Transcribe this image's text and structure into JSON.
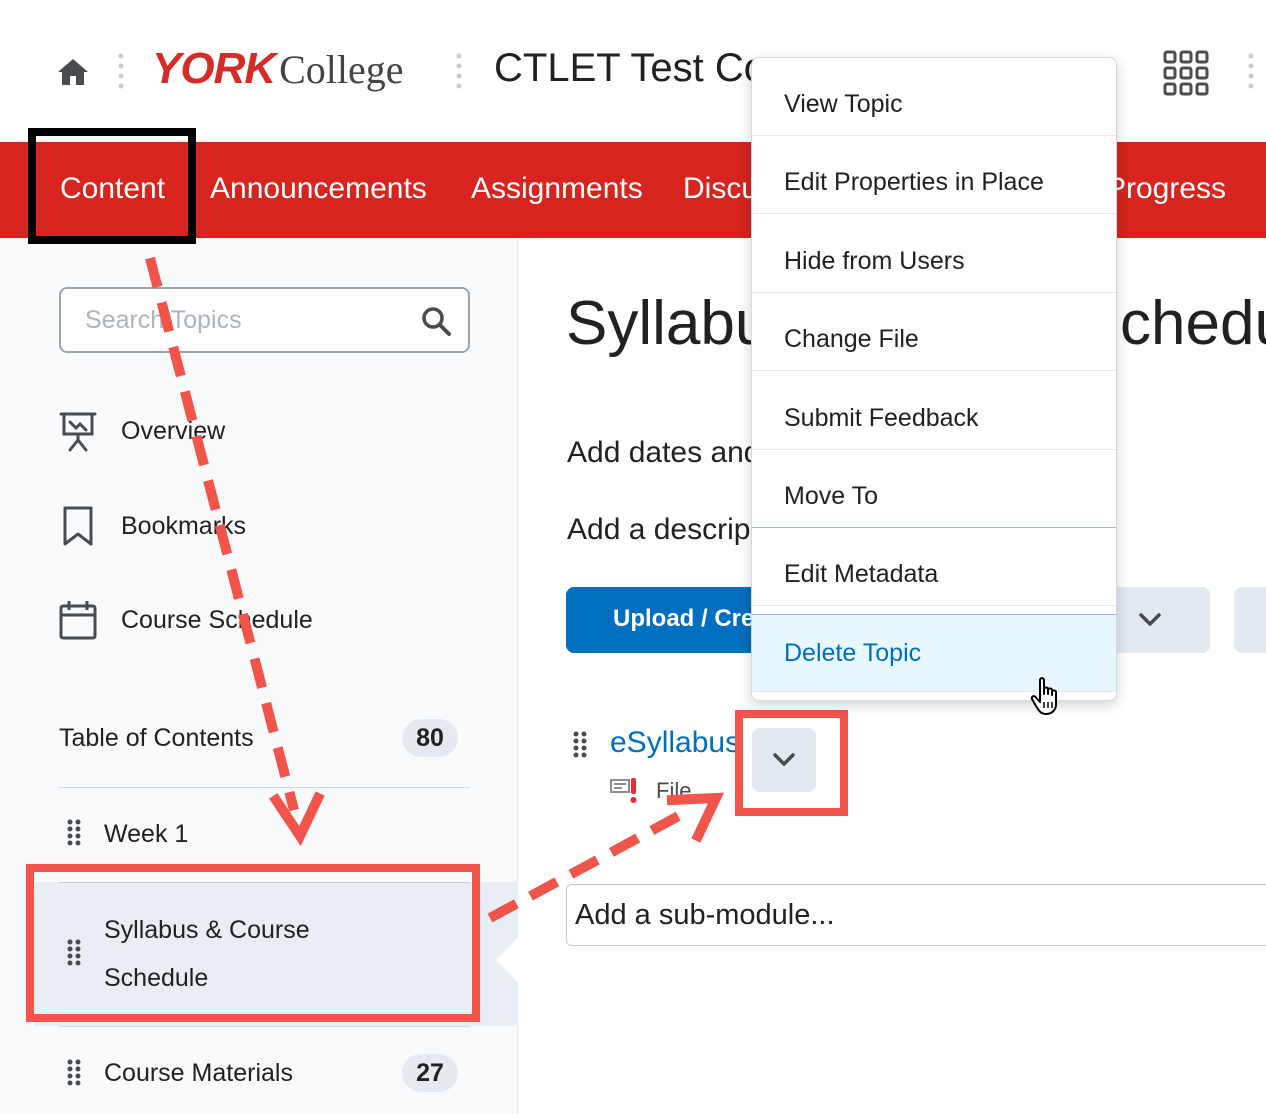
{
  "header": {
    "logo_york": "YORK",
    "logo_college": "College",
    "course_title": "CTLET Test Co"
  },
  "nav": {
    "items": [
      {
        "label": "Content"
      },
      {
        "label": "Announcements"
      },
      {
        "label": "Assignments"
      },
      {
        "label": "Discu"
      },
      {
        "label": "Progress"
      }
    ]
  },
  "sidebar": {
    "search_placeholder": "Search Topics",
    "links": [
      {
        "label": "Overview",
        "icon": "presentation-board-icon"
      },
      {
        "label": "Bookmarks",
        "icon": "bookmark-icon"
      },
      {
        "label": "Course Schedule",
        "icon": "calendar-icon"
      }
    ],
    "toc_title": "Table of Contents",
    "toc_count": "80",
    "modules": [
      {
        "label": "Week 1"
      },
      {
        "label_line1": "Syllabus & Course",
        "label_line2": "Schedule"
      },
      {
        "label": "Course Materials",
        "count": "27"
      }
    ]
  },
  "main": {
    "title_left": "Syllabu",
    "title_right": "chedu",
    "add_dates": "Add dates and",
    "add_description": "Add a descrip",
    "upload_label": "Upload / Crea",
    "topic": {
      "name": "eSyllabus",
      "type": "File"
    },
    "add_submodule": "Add a sub-module..."
  },
  "dropdown": {
    "items": [
      {
        "label": "View Topic"
      },
      {
        "label": "Edit Properties in Place"
      },
      {
        "label": "Hide from Users"
      },
      {
        "label": "Change File"
      },
      {
        "label": "Submit Feedback"
      },
      {
        "label": "Move To"
      },
      {
        "label": "Edit Metadata"
      },
      {
        "label": "Delete Topic"
      }
    ],
    "hovered": "Delete Topic"
  },
  "colors": {
    "brand_red": "#d7241e",
    "link_blue": "#006fbf",
    "annotation_red": "#f0544a",
    "hover_bg": "#e8f7fd"
  }
}
